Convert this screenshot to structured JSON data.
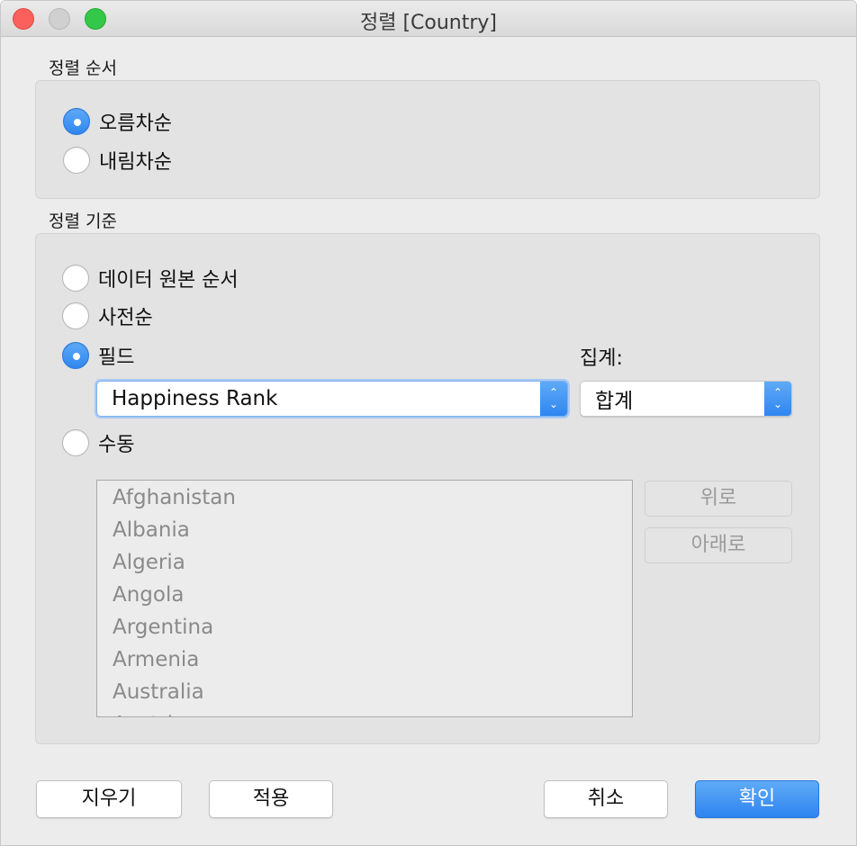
{
  "window": {
    "title": "정렬 [Country]"
  },
  "sort_order": {
    "label": "정렬 순서",
    "options": [
      {
        "label": "오름차순",
        "selected": true
      },
      {
        "label": "내림차순",
        "selected": false
      }
    ]
  },
  "sort_by": {
    "label": "정렬 기준",
    "options": [
      {
        "label": "데이터 원본 순서",
        "selected": false
      },
      {
        "label": "사전순",
        "selected": false
      },
      {
        "label": "필드",
        "selected": true
      },
      {
        "label": "수동",
        "selected": false
      }
    ],
    "field_select": {
      "value": "Happiness Rank"
    },
    "aggregation_label": "집계:",
    "aggregation_select": {
      "value": "합계"
    },
    "manual_list": [
      "Afghanistan",
      "Albania",
      "Algeria",
      "Angola",
      "Argentina",
      "Armenia",
      "Australia",
      "Austria"
    ],
    "up_label": "위로",
    "down_label": "아래로"
  },
  "footer": {
    "clear_label": "지우기",
    "apply_label": "적용",
    "cancel_label": "취소",
    "ok_label": "확인"
  },
  "colors": {
    "accent": "#2f86f0",
    "close": "#fc605c",
    "zoom": "#34c84a"
  },
  "icons": {
    "popup_arrows": "updown-chevron-icon"
  }
}
